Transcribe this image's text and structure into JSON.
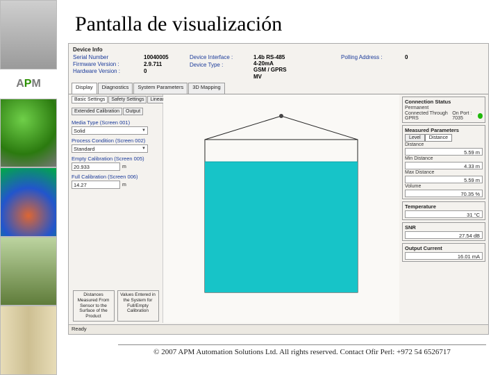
{
  "page": {
    "title": "Pantalla de visualización",
    "footer": "© 2007 APM Automation Solutions Ltd. All rights reserved. Contact Ofir Perl: +972 54 6526717"
  },
  "logo": {
    "a": "A",
    "p": "P",
    "m": "M"
  },
  "sidebar": {
    "thumbs": [
      "silo photo",
      "sensor photo",
      "mound render",
      "agitator photo",
      "pipes photo"
    ]
  },
  "device_info": {
    "section_title": "Device Info",
    "serial_number_label": "Serial Number",
    "serial_number": "10040005",
    "firmware_label": "Firmware Version :",
    "firmware": "2.9.711",
    "hardware_label": "Hardware Version :",
    "hardware": "0",
    "device_interface_label": "Device Interface :",
    "device_interface": "1.4b    RS-485\n4-20mA\nGSM / GPRS",
    "device_type_label": "Device Type :",
    "device_type": "MV",
    "polling_label": "Polling Address :",
    "polling": "0"
  },
  "tabs": [
    "Display",
    "Diagnostics",
    "System Parameters",
    "3D Mapping"
  ],
  "subtabs": [
    "Basic Settings",
    "Safety Settings",
    "Linearization",
    "Extended Calibration",
    "Output"
  ],
  "left": {
    "media_type_label": "Media Type (Screen 001)",
    "media_type_value": "Solid",
    "process_cond_label": "Process Condition (Screen 002)",
    "process_cond_value": "Standard",
    "empty_cal_label": "Empty Calibration (Screen 005)",
    "empty_cal_value": "20.933",
    "empty_cal_unit": "m",
    "full_cal_label": "Full Calibration (Screen 006)",
    "full_cal_value": "14.27",
    "full_cal_unit": "m",
    "note1": "Distances Measured From Sensor to the Surface of the Product",
    "note2": "Values Entered in the System for Full/Empty Calibration"
  },
  "right": {
    "conn_title": "Connection Status",
    "permanent": "Permanent",
    "connected_label": "Connected Through GPRS",
    "onport_label": "On Port : 7035",
    "measured_title": "Measured Parameters",
    "toggle_level": "Level",
    "toggle_distance": "Distance",
    "dist_title": "Distance",
    "dist_value": "5.59 m",
    "min_dist_title": "Min Distance",
    "min_dist_value": "4.33 m",
    "max_dist_title": "Max Distance",
    "max_dist_value": "5.59 m",
    "volume_title": "Volume",
    "volume_value": "70.35 %",
    "temp_title": "Temperature",
    "temp_value": "31 °C",
    "snr_title": "SNR",
    "snr_value": "27.54 dB",
    "output_title": "Output Current",
    "output_value": "16.01 mA"
  },
  "statusbar": {
    "text": "Ready"
  }
}
